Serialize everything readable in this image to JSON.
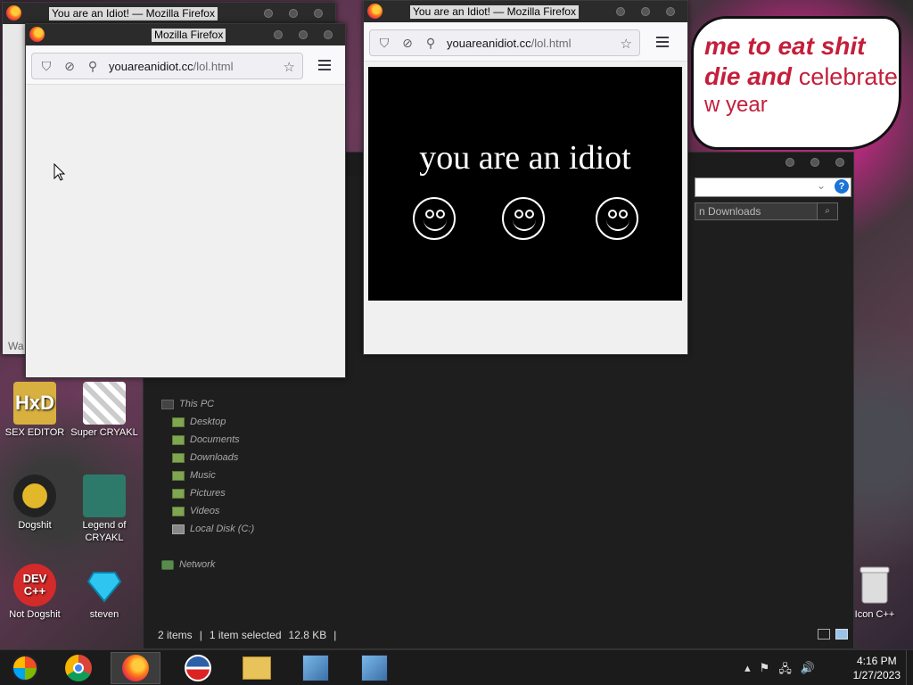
{
  "banner": {
    "line1": "me to eat shit",
    "line2_bold": "die and ",
    "line2_soft": "celebrate",
    "line3": "w year"
  },
  "desktop_icons": [
    {
      "label": "SEX EDITOR",
      "icon": "hex-editor-icon"
    },
    {
      "label": "Super CRYAKL",
      "icon": "pixel-game-icon"
    },
    {
      "label": "Dogshit",
      "icon": "disc-icon"
    },
    {
      "label": "Legend of CRYAKL",
      "icon": "pixel-character-icon"
    },
    {
      "label": "Not Dogshit",
      "icon": "dev-cpp-icon"
    },
    {
      "label": "steven",
      "icon": "diamond-icon"
    },
    {
      "label": "Icon C++",
      "icon": "recycle-bin-icon"
    }
  ],
  "dev_icon_text": {
    "line1": "DEV",
    "line2": "C++"
  },
  "explorer": {
    "search_placeholder": "n Downloads",
    "help": "?",
    "nav": [
      {
        "label": "This PC",
        "type": "pc"
      },
      {
        "label": "Desktop",
        "type": "folder"
      },
      {
        "label": "Documents",
        "type": "folder"
      },
      {
        "label": "Downloads",
        "type": "folder"
      },
      {
        "label": "Music",
        "type": "folder"
      },
      {
        "label": "Pictures",
        "type": "folder"
      },
      {
        "label": "Videos",
        "type": "folder"
      },
      {
        "label": "Local Disk (C:)",
        "type": "disk"
      },
      {
        "label": "Network",
        "type": "net"
      }
    ],
    "status": {
      "items": "2 items",
      "selected": "1 item selected",
      "size": "12.8 KB"
    },
    "left_clip_text": "Wa"
  },
  "firefox_back": {
    "title": "You are an Idiot! — Mozilla Firefox"
  },
  "firefox_left": {
    "title": "Mozilla Firefox",
    "url_host": "youareanidiot.cc",
    "url_path": "/lol.html"
  },
  "firefox_right": {
    "title": "You are an Idiot! — Mozilla Firefox",
    "url_host": "youareanidiot.cc",
    "url_path": "/lol.html",
    "content_text": "you are an idiot"
  },
  "taskbar": {
    "apps": [
      "start-orb-icon",
      "chrome-icon",
      "firefox-icon",
      "obama-logo-icon",
      "file-explorer-icon",
      "setup-icon",
      "setup-icon"
    ],
    "time": "4:16 PM",
    "date": "1/27/2023"
  },
  "colors": {
    "banner_red": "#c41e3a",
    "firefox_orange": "#ff7a18",
    "help_blue": "#1a73d8"
  }
}
